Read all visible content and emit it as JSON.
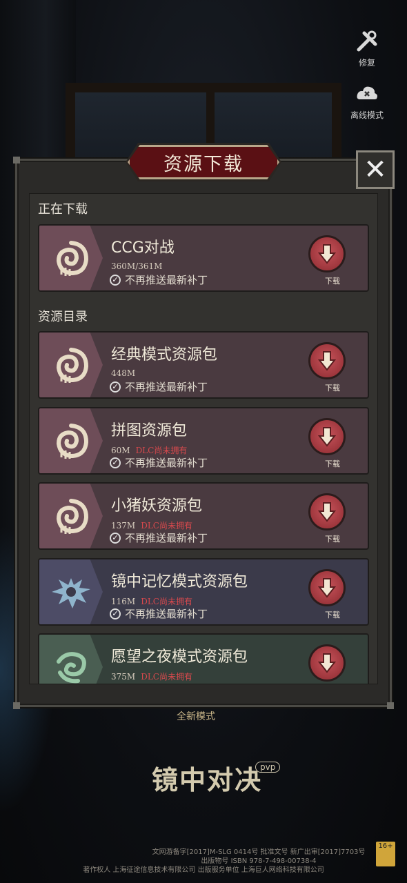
{
  "side": {
    "repair_label": "修复",
    "offline_label": "离线模式"
  },
  "dialog": {
    "title": "资源下载",
    "close_symbol": "✕",
    "downloading_section": "正在下载",
    "catalog_section": "资源目录",
    "no_push_label": "不再推送最新补丁",
    "download_label": "下载",
    "items": [
      {
        "name": "CCG对战",
        "size": "360M/361M",
        "dlc": "",
        "theme": "pink",
        "show_dl_label": true
      },
      {
        "name": "经典模式资源包",
        "size": "448M",
        "dlc": "",
        "theme": "pink",
        "show_dl_label": true
      },
      {
        "name": "拼图资源包",
        "size": "60M",
        "dlc": "DLC尚未拥有",
        "theme": "pink",
        "show_dl_label": true
      },
      {
        "name": "小猪妖资源包",
        "size": "137M",
        "dlc": "DLC尚未拥有",
        "theme": "pink",
        "show_dl_label": true
      },
      {
        "name": "镜中记忆模式资源包",
        "size": "116M",
        "dlc": "DLC尚未拥有",
        "theme": "blue",
        "show_dl_label": true
      },
      {
        "name": "愿望之夜模式资源包",
        "size": "375M",
        "dlc": "DLC尚未拥有",
        "theme": "green",
        "show_dl_label": false
      }
    ]
  },
  "background": {
    "mode_text": "全新模式",
    "logo_text": "镜中对决",
    "pvp_badge": "pvp",
    "footer_line1": "文网游备字[2017]M-SLG 0414号 批准文号 新广出审[2017]7703号",
    "footer_line2": "出版物号 ISBN 978-7-498-00738-4",
    "footer_line3": "著作权人 上海征途信息技术有限公司        出版服务单位 上海巨人网络科技有限公司",
    "age_rating": "16+"
  },
  "colors": {
    "dialog_bg": "#2b2a28",
    "title_plate": "#5a1014",
    "download_button": "#b8454b",
    "dlc_text": "#d7494d"
  }
}
